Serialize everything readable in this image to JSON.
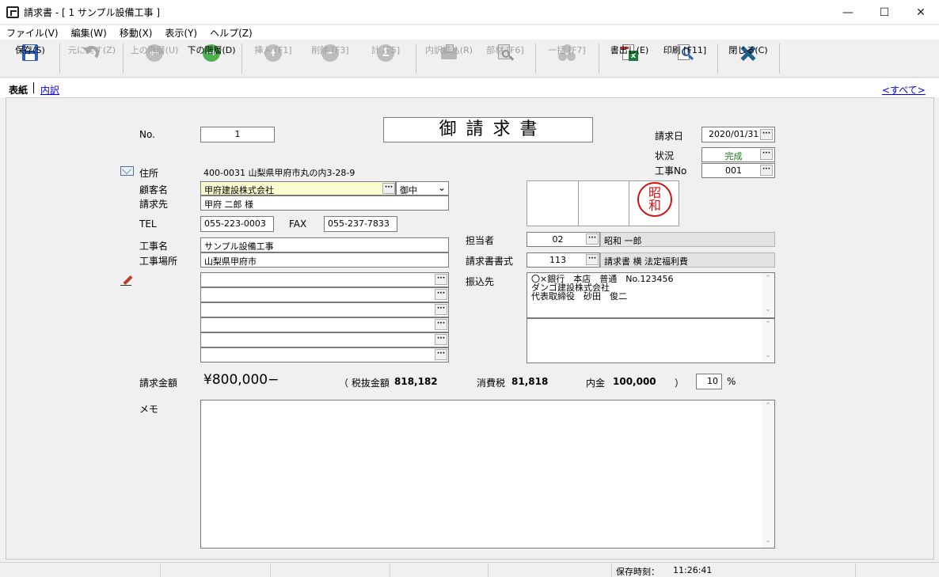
{
  "window": {
    "title": "請求書 - [ 1  サンプル設備工事 ]",
    "minimize": "—",
    "maximize": "☐",
    "close": "✕"
  },
  "menu": [
    "ファイル(V)",
    "編集(W)",
    "移動(X)",
    "表示(Y)",
    "ヘルプ(Z)"
  ],
  "toolbar": {
    "save": "保存(S)",
    "undo": "元に戻す(Z)",
    "up_level": "上の階層(U)",
    "down_level": "下の階層(D)",
    "insert": "挿入 [F1]",
    "delete": "削除 [F3]",
    "total": "計 [F5]",
    "import_detail": "内訳読込(R)",
    "material": "部材 [F6]",
    "batch": "一括 [F7]",
    "export": "書出し(E)",
    "print": "印刷 [F11]",
    "close": "閉じる(C)",
    "icon_sigma": "Σ",
    "icon_plus": "+",
    "icon_minus": "−",
    "icon_arrow": "→",
    "icon_arrow_left": "←"
  },
  "tabs": {
    "cover": "表紙",
    "detail": "内訳",
    "all": "<すべて>"
  },
  "form": {
    "no_label": "No.",
    "no_value": "1",
    "heading": "御請求書",
    "invoice_date_label": "請求日",
    "invoice_date": "2020/01/31",
    "status_label": "状況",
    "status_value": "完成",
    "job_no_label": "工事No",
    "job_no": "001",
    "address_label": "住所",
    "address_value": "400-0031 山梨県甲府市丸の内3-28-9",
    "customer_label": "顧客名",
    "customer_value": "甲府建設株式会社",
    "honorific": "御中",
    "bill_to_label": "請求先",
    "bill_to_value": "甲府 二郎 様",
    "tel_label": "TEL",
    "tel_value": "055-223-0003",
    "fax_label": "FAX",
    "fax_value": "055-237-7833",
    "job_name_label": "工事名",
    "job_name_value": "サンプル設備工事",
    "site_label": "工事場所",
    "site_value": "山梨県甲府市",
    "staff_label": "担当者",
    "staff_code": "02",
    "staff_name": "昭和 一郎",
    "format_label": "請求書書式",
    "format_code": "113",
    "format_name": "請求書 横 法定福利費",
    "transfer_label": "振込先",
    "transfer_lines": [
      "〇×銀行　本店　普通　No.123456",
      "ダンゴ建設株式会社",
      "代表取締役　砂田　俊二"
    ],
    "seal_text_1": "昭",
    "seal_text_2": "和",
    "amount_label": "請求金額",
    "amount_value": "¥800,000−",
    "ex_tax_label": "（ 税抜金額",
    "ex_tax_value": "818,182",
    "tax_label": "消費税",
    "tax_value": "81,818",
    "deposit_label": "内金",
    "deposit_value": "100,000",
    "close_paren": "）",
    "tax_rate": "10",
    "percent": "%",
    "memo_label": "メモ",
    "dots": "···",
    "scroll_up": "⌃",
    "scroll_down": "⌄",
    "dropdown": "⌄"
  },
  "status": {
    "saved_label": "保存時刻：",
    "saved_time": "11:26:41"
  }
}
